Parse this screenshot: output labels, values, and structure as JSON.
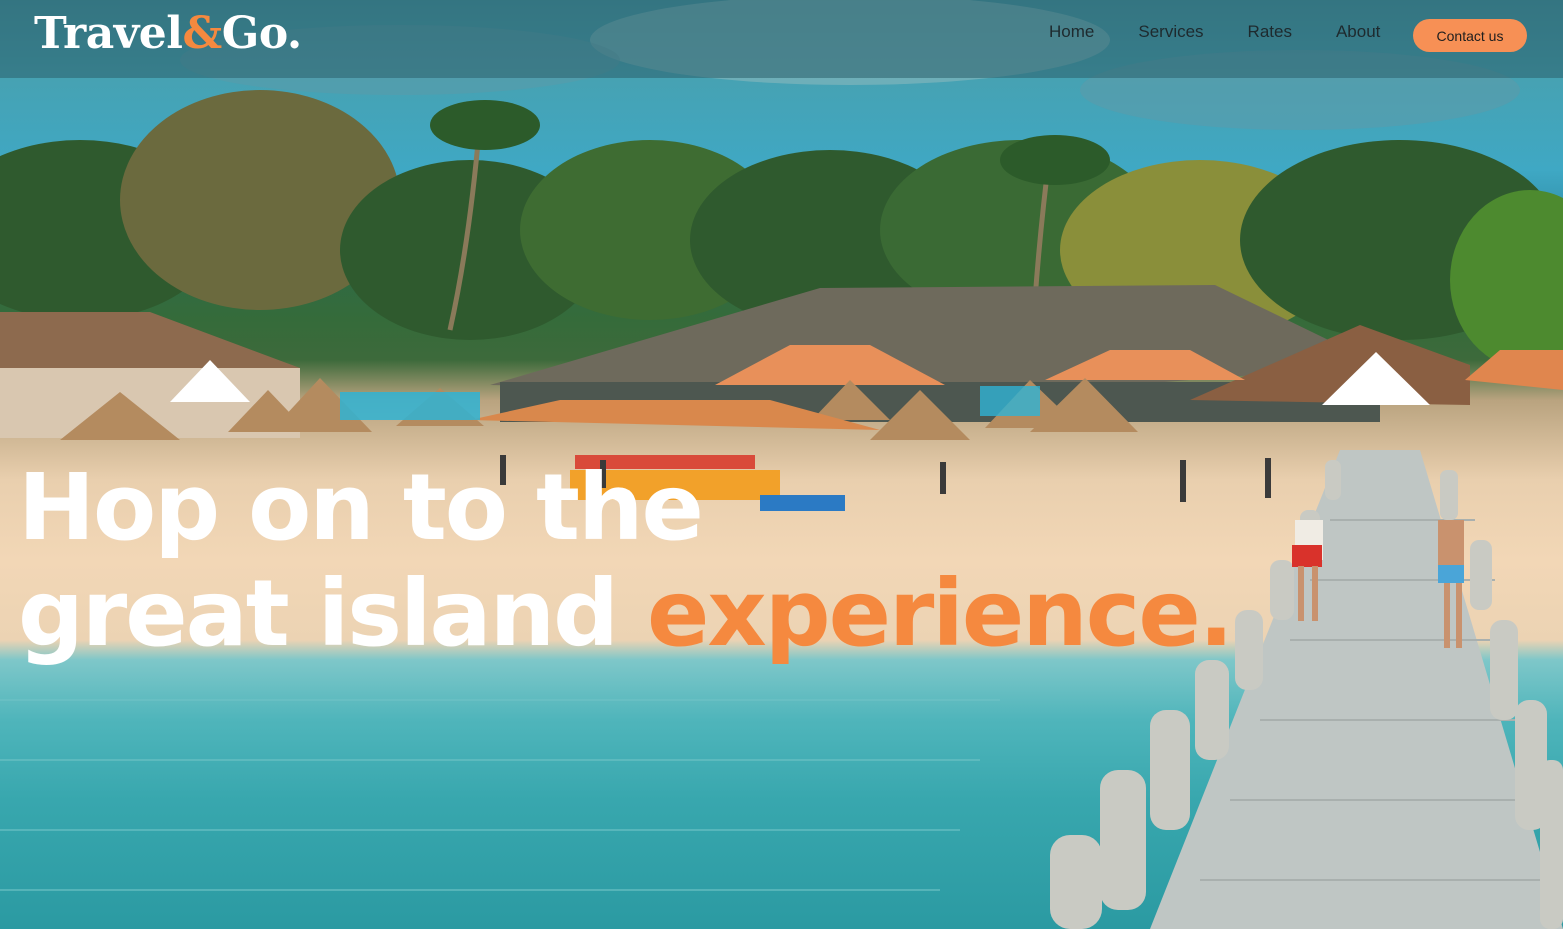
{
  "brand": {
    "name_part1": "Travel",
    "ampersand": "&",
    "name_part2": "Go.",
    "accent_color": "#f5893f"
  },
  "nav": {
    "items": [
      {
        "label": "Home"
      },
      {
        "label": "Services"
      },
      {
        "label": "Rates"
      },
      {
        "label": "About"
      }
    ],
    "cta_label": "Contact us",
    "cta_color": "#f79055"
  },
  "hero": {
    "line1": "Hop on to the",
    "line2_plain": "great island",
    "line2_accent": "experience.",
    "background_description_icon": "beach-resort-photo"
  }
}
